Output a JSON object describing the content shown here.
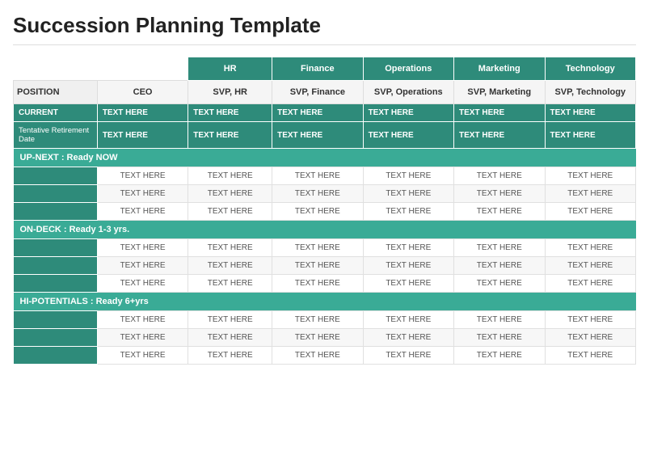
{
  "title": "Succession Planning Template",
  "columns": {
    "col0": "",
    "col1": "CEO",
    "col2": "HR",
    "col3": "Finance",
    "col4": "Operations",
    "col5": "Marketing",
    "col6": "Technology"
  },
  "position_row": {
    "label": "POSITION",
    "ceo": "CEO",
    "hr": "SVP, HR",
    "finance": "SVP, Finance",
    "operations": "SVP, Operations",
    "marketing": "SVP, Marketing",
    "technology": "SVP, Technology"
  },
  "sections": {
    "current_label": "CURRENT",
    "tentative_label": "Tentative Retirement Date",
    "up_next_label": "UP-NEXT : Ready NOW",
    "on_deck_label": "ON-DECK : Ready 1-3 yrs.",
    "hi_potentials_label": "HI-POTENTIALS : Ready 6+yrs"
  },
  "placeholder": "TEXT HERE"
}
